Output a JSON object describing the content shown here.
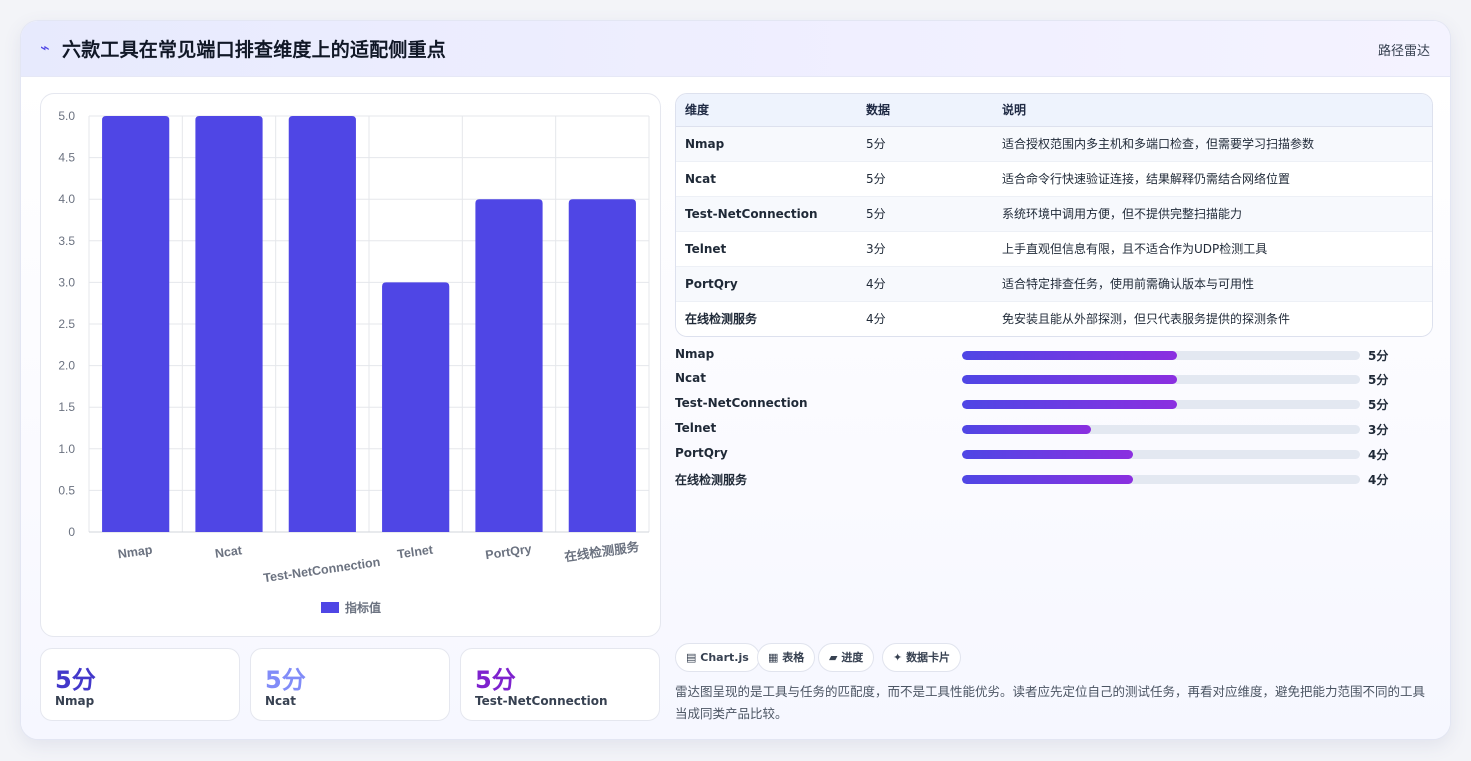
{
  "header": {
    "icon": "spark-icon",
    "title": "六款工具在常见端口排查维度上的适配侧重点",
    "link": "路径雷达"
  },
  "colors": {
    "bar": "#4f46e5",
    "gradient_start": "#4f46e5",
    "gradient_end": "#8b2fe0",
    "stat_1": "#4338ca",
    "stat_2": "#818cf8",
    "stat_3": "#7e22ce"
  },
  "chart_data": {
    "type": "bar",
    "categories": [
      "Nmap",
      "Ncat",
      "Test-NetConnection",
      "Telnet",
      "PortQry",
      "在线检测服务"
    ],
    "series": [
      {
        "name": "指标值",
        "values": [
          5,
          5,
          5,
          3,
          4,
          4
        ]
      }
    ],
    "ylim": [
      0,
      5
    ],
    "yticks": [
      "5.0",
      "4.5",
      "4.0",
      "3.5",
      "3.0",
      "2.5",
      "2.0",
      "1.5",
      "1.0",
      "0.5",
      "0"
    ],
    "grid": true,
    "legend": "bottom"
  },
  "stats": [
    {
      "value": "5分",
      "label": "Nmap"
    },
    {
      "value": "5分",
      "label": "Ncat"
    },
    {
      "value": "5分",
      "label": "Test-NetConnection"
    }
  ],
  "table": {
    "headers": [
      "维度",
      "数据",
      "说明"
    ],
    "rows": [
      [
        "Nmap",
        "5分",
        "适合授权范围内多主机和多端口检查，但需要学习扫描参数"
      ],
      [
        "Ncat",
        "5分",
        "适合命令行快速验证连接，结果解释仍需结合网络位置"
      ],
      [
        "Test-NetConnection",
        "5分",
        "系统环境中调用方便，但不提供完整扫描能力"
      ],
      [
        "Telnet",
        "3分",
        "上手直观但信息有限，且不适合作为UDP检测工具"
      ],
      [
        "PortQry",
        "4分",
        "适合特定排查任务，使用前需确认版本与可用性"
      ],
      [
        "在线检测服务",
        "4分",
        "免安装且能从外部探测，但只代表服务提供的探测条件"
      ]
    ]
  },
  "progress": [
    {
      "name": "Nmap",
      "score": "5分",
      "fraction": 0.54
    },
    {
      "name": "Ncat",
      "score": "5分",
      "fraction": 0.54
    },
    {
      "name": "Test-NetConnection",
      "score": "5分",
      "fraction": 0.54
    },
    {
      "name": "Telnet",
      "score": "3分",
      "fraction": 0.325
    },
    {
      "name": "PortQry",
      "score": "4分",
      "fraction": 0.43
    },
    {
      "name": "在线检测服务",
      "score": "4分",
      "fraction": 0.43
    }
  ],
  "chips": [
    {
      "icon": "chart-icon",
      "glyph": "▤",
      "label": "Chart.js"
    },
    {
      "icon": "table-icon",
      "glyph": "▦",
      "label": "表格"
    },
    {
      "icon": "progress-icon",
      "glyph": "▰",
      "label": "进度"
    },
    {
      "icon": "sparkle-icon",
      "glyph": "✦",
      "label": "数据卡片"
    }
  ],
  "note": "雷达图呈现的是工具与任务的匹配度，而不是工具性能优劣。读者应先定位自己的测试任务，再看对应维度，避免把能力范围不同的工具当成同类产品比较。"
}
